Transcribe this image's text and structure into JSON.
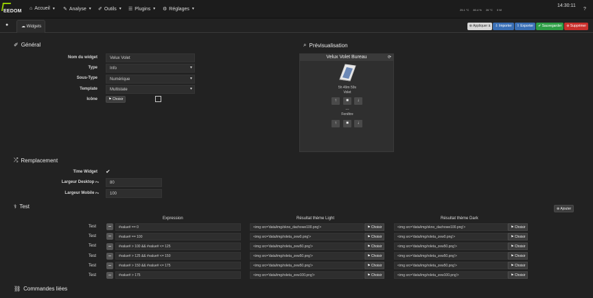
{
  "navbar": {
    "logo_text": "EEDOM",
    "menus": [
      {
        "label": "Accueil",
        "icon": "⌂"
      },
      {
        "label": "Analyse",
        "icon": "✎"
      },
      {
        "label": "Outils",
        "icon": "✐"
      },
      {
        "label": "Plugins",
        "icon": "☰"
      },
      {
        "label": "Réglages",
        "icon": "⚙"
      }
    ],
    "status": [
      "25.1 °C",
      "80.4 %",
      "26 °C",
      "0 W"
    ],
    "time": "14:30:11",
    "help_icon": "?"
  },
  "tabbar": {
    "tab_label": "Widgets",
    "actions": {
      "apply": "Appliquer à",
      "import": "Importer",
      "export": "Exporter",
      "save": "Sauvegarder",
      "delete": "Supprimer"
    }
  },
  "general": {
    "title": "Général",
    "widget_name_label": "Nom du widget",
    "widget_name_value": "Velux Volet",
    "type_label": "Type",
    "type_value": "Info",
    "subtype_label": "Sous-Type",
    "subtype_value": "Numérique",
    "template_label": "Template",
    "template_value": "Multistate",
    "icon_label": "Icône",
    "choose_label": "Choisir"
  },
  "preview": {
    "title": "Prévisualisation",
    "widget_title": "Velux Volet Bureau",
    "time_text": "5h 49m 59s",
    "volet_label": "Volet",
    "fenetre_dash": "---",
    "fenetre_label": "Fenêtre"
  },
  "replacement": {
    "title": "Remplacement",
    "time_widget_label": "Time Widget",
    "desktop_label": "Largeur Desktop",
    "desktop_unit": "Px",
    "desktop_value": "80",
    "mobile_label": "Largeur Mobile",
    "mobile_unit": "Px",
    "mobile_value": "100"
  },
  "test": {
    "title": "Test",
    "add_label": "Ajouter",
    "headers": {
      "expression": "Expression",
      "light": "Résultat thème Light",
      "dark": "Résultat thème Dark"
    },
    "row_label": "Test",
    "choose_label": "Choisir",
    "rows": [
      {
        "expr": "#value# == 0",
        "light": "<img src='data/img/okno_dachowe100.png'>",
        "dark": "<img src='data/img/okno_dachowe100.png'>"
      },
      {
        "expr": "#value# == 100",
        "light": "<img src='data/img/roleta_zew0.png'>",
        "dark": "<img src='data/img/roleta_zew0.png'>"
      },
      {
        "expr": "#value# > 100 && #value# <= 125",
        "light": "<img src='data/img/roleta_zew50.png'>",
        "dark": "<img src='data/img/roleta_zew50.png'>"
      },
      {
        "expr": "#value# > 125 && #value# <= 150",
        "light": "<img src='data/img/roleta_zew50.png'>",
        "dark": "<img src='data/img/roleta_zew50.png'>"
      },
      {
        "expr": "#value# > 150 && #value# <= 175",
        "light": "<img src='data/img/roleta_zew50.png'>",
        "dark": "<img src='data/img/roleta_zew50.png'>"
      },
      {
        "expr": "#value# > 175",
        "light": "<img src='data/img/roleta_zew100.png'>",
        "dark": "<img src='data/img/roleta_zew100.png'>"
      }
    ]
  },
  "linked": {
    "title": "Commandes liées"
  },
  "colors": {
    "brand": "#94ca02",
    "background": "#222222",
    "import": "#3a6fb5",
    "save": "#2e9e46",
    "delete": "#c9302c"
  }
}
